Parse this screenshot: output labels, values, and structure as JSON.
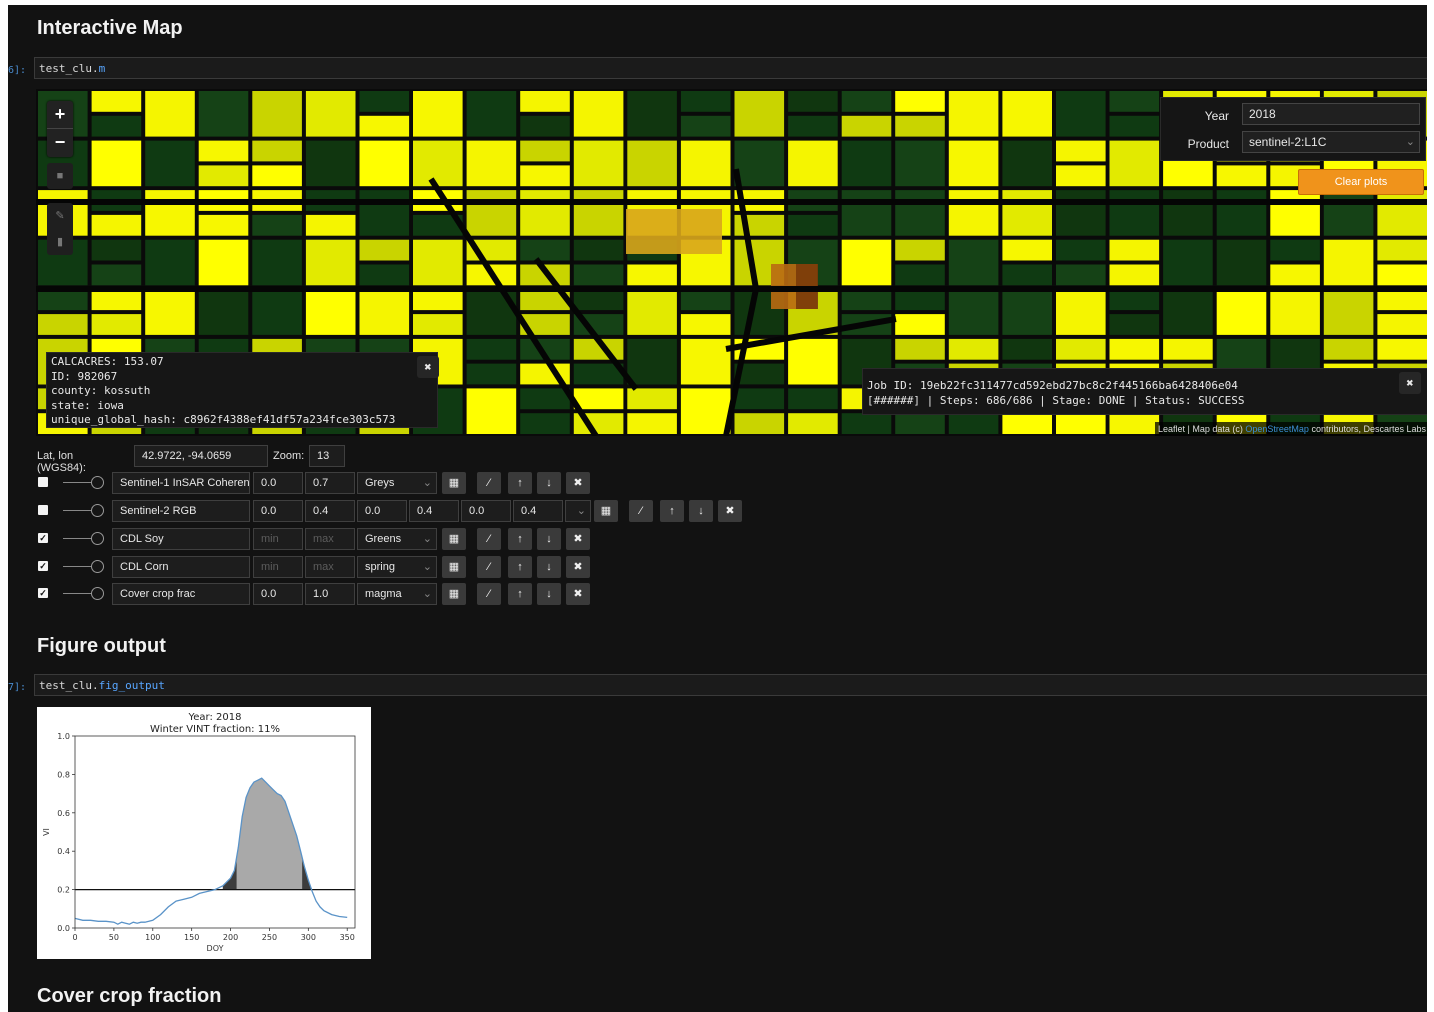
{
  "sections": {
    "map_title": "Interactive Map",
    "figure_title": "Figure output",
    "cover_title": "Cover crop fraction"
  },
  "cells": {
    "map_prompt": "6]:",
    "map_obj": "test_clu.",
    "map_attr": "m",
    "fig_prompt": "7]:",
    "fig_obj": "test_clu.",
    "fig_attr": "fig_output"
  },
  "map": {
    "zoom_in": "+",
    "zoom_out": "−",
    "feature_popup": {
      "lines": [
        "CALCACRES: 153.07",
        "ID: 982067",
        "county: kossuth",
        "state: iowa",
        "unique_global_hash: c8962f4388ef41df57a234fce303c573"
      ]
    },
    "job_popup": {
      "line1": "Job ID: 19eb22fc311477cd592ebd27bc8c2f445166ba6428406e04",
      "line2": "[######] | Steps: 686/686 | Stage: DONE | Status: SUCCESS"
    },
    "year_label": "Year",
    "year_value": "2018",
    "product_label": "Product",
    "product_value": "sentinel-2:L1C",
    "clear_button": "Clear plots",
    "attribution_prefix": "Leaflet | Map data (c) ",
    "attribution_link": "OpenStreetMap",
    "attribution_suffix": " contributors, Descartes Labs",
    "close_glyph": "✖"
  },
  "controls": {
    "latlon_label": "Lat, lon (WGS84):",
    "latlon_value": "42.9722, -94.0659",
    "zoom_label": "Zoom:",
    "zoom_value": "13"
  },
  "layers": [
    {
      "checked": false,
      "name": "Sentinel-1 InSAR Coheren",
      "min": "0.0",
      "max": "0.7",
      "colormap": "Greys"
    },
    {
      "checked": false,
      "name": "Sentinel-2 RGB",
      "r_min": "0.0",
      "r_max": "0.4",
      "g_min": "0.0",
      "g_max": "0.4",
      "b_min": "0.0",
      "b_max": "0.4"
    },
    {
      "checked": true,
      "name": "CDL Soy",
      "min_placeholder": "min",
      "max_placeholder": "max",
      "colormap": "Greens"
    },
    {
      "checked": true,
      "name": "CDL Corn",
      "min_placeholder": "min",
      "max_placeholder": "max",
      "colormap": "spring"
    },
    {
      "checked": true,
      "name": "Cover crop frac",
      "min": "0.0",
      "max": "1.0",
      "colormap": "magma"
    }
  ],
  "icons": {
    "check": "✓",
    "grid": "▦",
    "wand": "⁄",
    "up": "↑",
    "down": "↓",
    "remove": "✖",
    "dropdown": "⌄"
  },
  "chart_data": {
    "type": "area",
    "title": "Year: 2018",
    "subtitle": "Winter VINT fraction: 11%",
    "xlabel": "DOY",
    "ylabel": "VI",
    "xlim": [
      0,
      360
    ],
    "ylim": [
      0,
      1.0
    ],
    "xticks": [
      0,
      50,
      100,
      150,
      200,
      250,
      300,
      350
    ],
    "yticks": [
      0.0,
      0.2,
      0.4,
      0.6,
      0.8,
      1.0
    ],
    "threshold": 0.2,
    "series": [
      {
        "x": [
          0,
          10,
          20,
          30,
          40,
          50,
          55,
          60,
          65,
          70,
          75,
          80,
          85,
          90,
          95,
          100,
          110,
          120,
          130,
          140,
          150,
          160,
          170,
          180,
          190,
          200,
          205,
          210,
          215,
          220,
          225,
          230,
          235,
          240,
          245,
          250,
          255,
          260,
          265,
          270,
          275,
          280,
          285,
          290,
          295,
          300,
          305,
          310,
          315,
          320,
          330,
          340,
          350
        ],
        "y": [
          0.05,
          0.04,
          0.04,
          0.035,
          0.035,
          0.03,
          0.02,
          0.03,
          0.025,
          0.02,
          0.03,
          0.025,
          0.03,
          0.03,
          0.035,
          0.04,
          0.07,
          0.11,
          0.14,
          0.15,
          0.16,
          0.18,
          0.19,
          0.2,
          0.22,
          0.26,
          0.3,
          0.42,
          0.58,
          0.68,
          0.73,
          0.76,
          0.77,
          0.78,
          0.76,
          0.74,
          0.72,
          0.7,
          0.69,
          0.66,
          0.6,
          0.54,
          0.48,
          0.4,
          0.32,
          0.25,
          0.19,
          0.14,
          0.11,
          0.09,
          0.07,
          0.06,
          0.055
        ]
      }
    ],
    "fills": [
      {
        "name": "early",
        "from": 190,
        "to": 208,
        "color": "#3c3c3c"
      },
      {
        "name": "main",
        "from": 208,
        "to": 292,
        "color": "#a9a9a9"
      },
      {
        "name": "late",
        "from": 292,
        "to": 312,
        "color": "#3c3c3c"
      }
    ],
    "line_color": "#5a93c8"
  }
}
